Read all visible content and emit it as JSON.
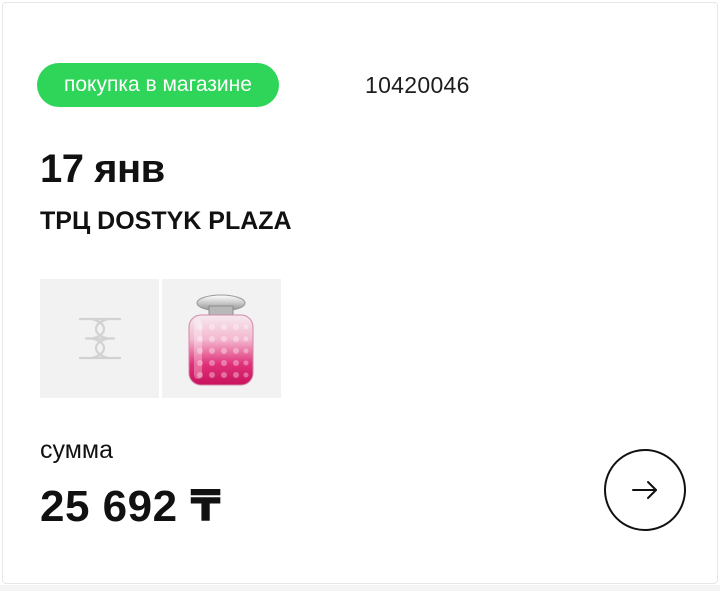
{
  "order": {
    "type_badge": "покупка в магазине",
    "number": "10420046",
    "date": "17 янв",
    "store": "ТРЦ DOSTYK PLAZA"
  },
  "products": [
    {
      "icon": "brand-placeholder-icon"
    },
    {
      "icon": "perfume-bottle-image"
    }
  ],
  "summary": {
    "label": "сумма",
    "amount": "25 692 ₸"
  },
  "colors": {
    "badge_bg": "#2fd558",
    "text": "#111111"
  },
  "actions": {
    "open_icon": "arrow-right-icon"
  }
}
